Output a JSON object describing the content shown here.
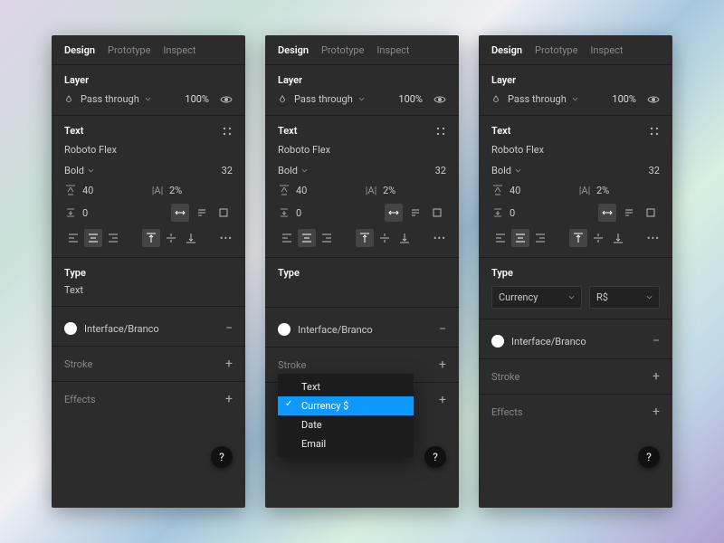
{
  "tabs": {
    "design": "Design",
    "prototype": "Prototype",
    "inspect": "Inspect"
  },
  "layer": {
    "title": "Layer",
    "blend_mode": "Pass through",
    "opacity": "100%"
  },
  "text": {
    "title": "Text",
    "font": "Roboto Flex",
    "weight": "Bold",
    "size": "32",
    "line_height": "40",
    "letter_spacing": "2%",
    "paragraph_spacing": "0"
  },
  "type": {
    "title": "Type",
    "value_text": "Text",
    "value_currency": "Currency",
    "value_symbol": "R$",
    "menu": [
      "Text",
      "Currency $",
      "Date",
      "Email"
    ]
  },
  "fill": {
    "label": "Interface/Branco"
  },
  "stroke": {
    "label": "Stroke"
  },
  "effects": {
    "label": "Effects"
  }
}
